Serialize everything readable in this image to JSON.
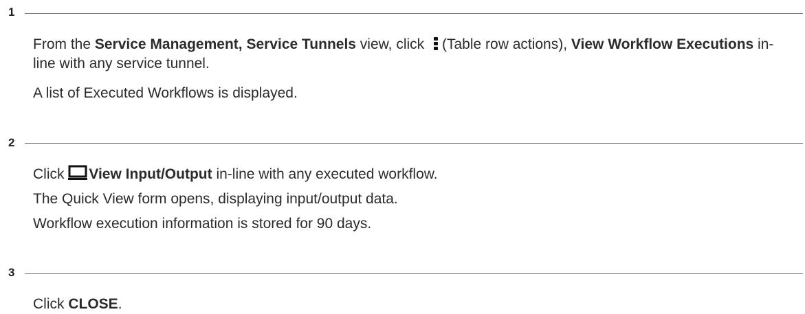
{
  "steps": [
    {
      "number": "1",
      "paragraphs": {
        "p1": {
          "t1": "From the ",
          "b1": "Service Management, Service Tunnels",
          "t2": " view, click ",
          "icon_label": "(Table row actions), ",
          "b2": "View Workflow Executions",
          "t3": " in-line with any service tunnel."
        },
        "p2": "A list of Executed Workflows is displayed."
      },
      "icon": "kebab-vertical-icon"
    },
    {
      "number": "2",
      "paragraphs": {
        "p1": {
          "t1": "Click ",
          "b1": "View Input/Output",
          "t2": " in-line with any executed workflow."
        },
        "p2": "The Quick View form opens, displaying input/output data.",
        "p3": "Workflow execution information is stored for 90 days."
      },
      "icon": "monitor-icon"
    },
    {
      "number": "3",
      "paragraphs": {
        "p1": {
          "t1": "Click ",
          "b1": "CLOSE",
          "t2": "."
        }
      }
    }
  ],
  "colors": {
    "text": "#2b2b2b",
    "rule": "#6a6a6a"
  }
}
